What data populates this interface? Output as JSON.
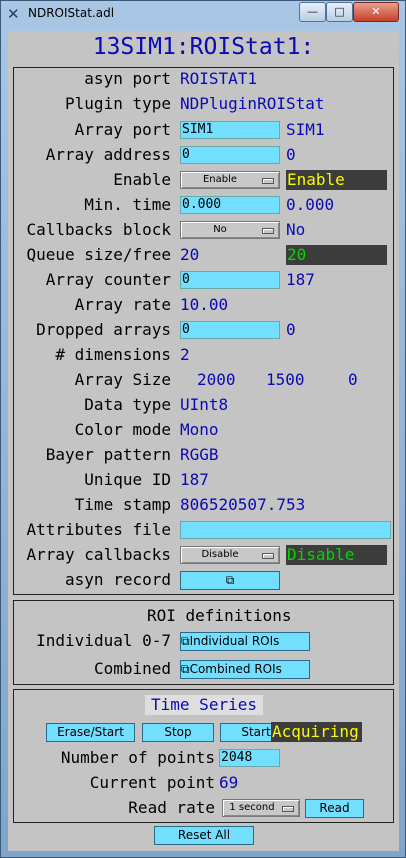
{
  "window": {
    "title": "NDROIStat.adl",
    "icon": "x-logo-icon",
    "min_label": "—",
    "max_label": "□",
    "close_label": "✕"
  },
  "header": {
    "title": "13SIM1:ROIStat1:"
  },
  "main": {
    "asyn_port": {
      "label": "asyn port",
      "value": "ROISTAT1"
    },
    "plugin_type": {
      "label": "Plugin type",
      "value": "NDPluginROIStat"
    },
    "array_port": {
      "label": "Array port",
      "input": "SIM1",
      "readback": "SIM1"
    },
    "array_address": {
      "label": "Array address",
      "input": "0",
      "readback": "0"
    },
    "enable": {
      "label": "Enable",
      "menu": "Enable",
      "readback": "Enable"
    },
    "min_time": {
      "label": "Min. time",
      "input": "0.000",
      "readback": "0.000"
    },
    "callbacks_block": {
      "label": "Callbacks block",
      "menu": "No",
      "readback": "No"
    },
    "queue": {
      "label": "Queue size/free",
      "size": "20",
      "free": "20"
    },
    "array_counter": {
      "label": "Array counter",
      "input": "0",
      "readback": "187"
    },
    "array_rate": {
      "label": "Array rate",
      "value": "10.00"
    },
    "dropped_arrays": {
      "label": "Dropped arrays",
      "input": "0",
      "readback": "0"
    },
    "dimensions": {
      "label": "# dimensions",
      "value": "2"
    },
    "array_size": {
      "label": "Array Size",
      "values": [
        "2000",
        "1500",
        "0"
      ]
    },
    "data_type": {
      "label": "Data type",
      "value": "UInt8"
    },
    "color_mode": {
      "label": "Color mode",
      "value": "Mono"
    },
    "bayer_pattern": {
      "label": "Bayer pattern",
      "value": "RGGB"
    },
    "unique_id": {
      "label": "Unique ID",
      "value": "187"
    },
    "time_stamp": {
      "label": "Time stamp",
      "value": "806520507.753"
    },
    "attributes_file": {
      "label": "Attributes file",
      "input": ""
    },
    "array_callbacks": {
      "label": "Array callbacks",
      "menu": "Disable",
      "readback": "Disable"
    },
    "asyn_record": {
      "label": "asyn record",
      "button": "⧉"
    }
  },
  "roi": {
    "title": "ROI definitions",
    "individual": {
      "label": "Individual 0-7",
      "button": "⧉Individual ROIs"
    },
    "combined": {
      "label": "Combined",
      "button": "⧉Combined ROIs"
    }
  },
  "timeseries": {
    "title": "Time Series",
    "erase_start": "Erase/Start",
    "stop": "Stop",
    "start": "Start",
    "status": "Acquiring",
    "num_points": {
      "label": "Number of points",
      "input": "2048"
    },
    "current_point": {
      "label": "Current point",
      "value": "69"
    },
    "read_rate": {
      "label": "Read rate",
      "menu": "1 second",
      "button": "Read"
    }
  },
  "reset_all": "Reset All"
}
